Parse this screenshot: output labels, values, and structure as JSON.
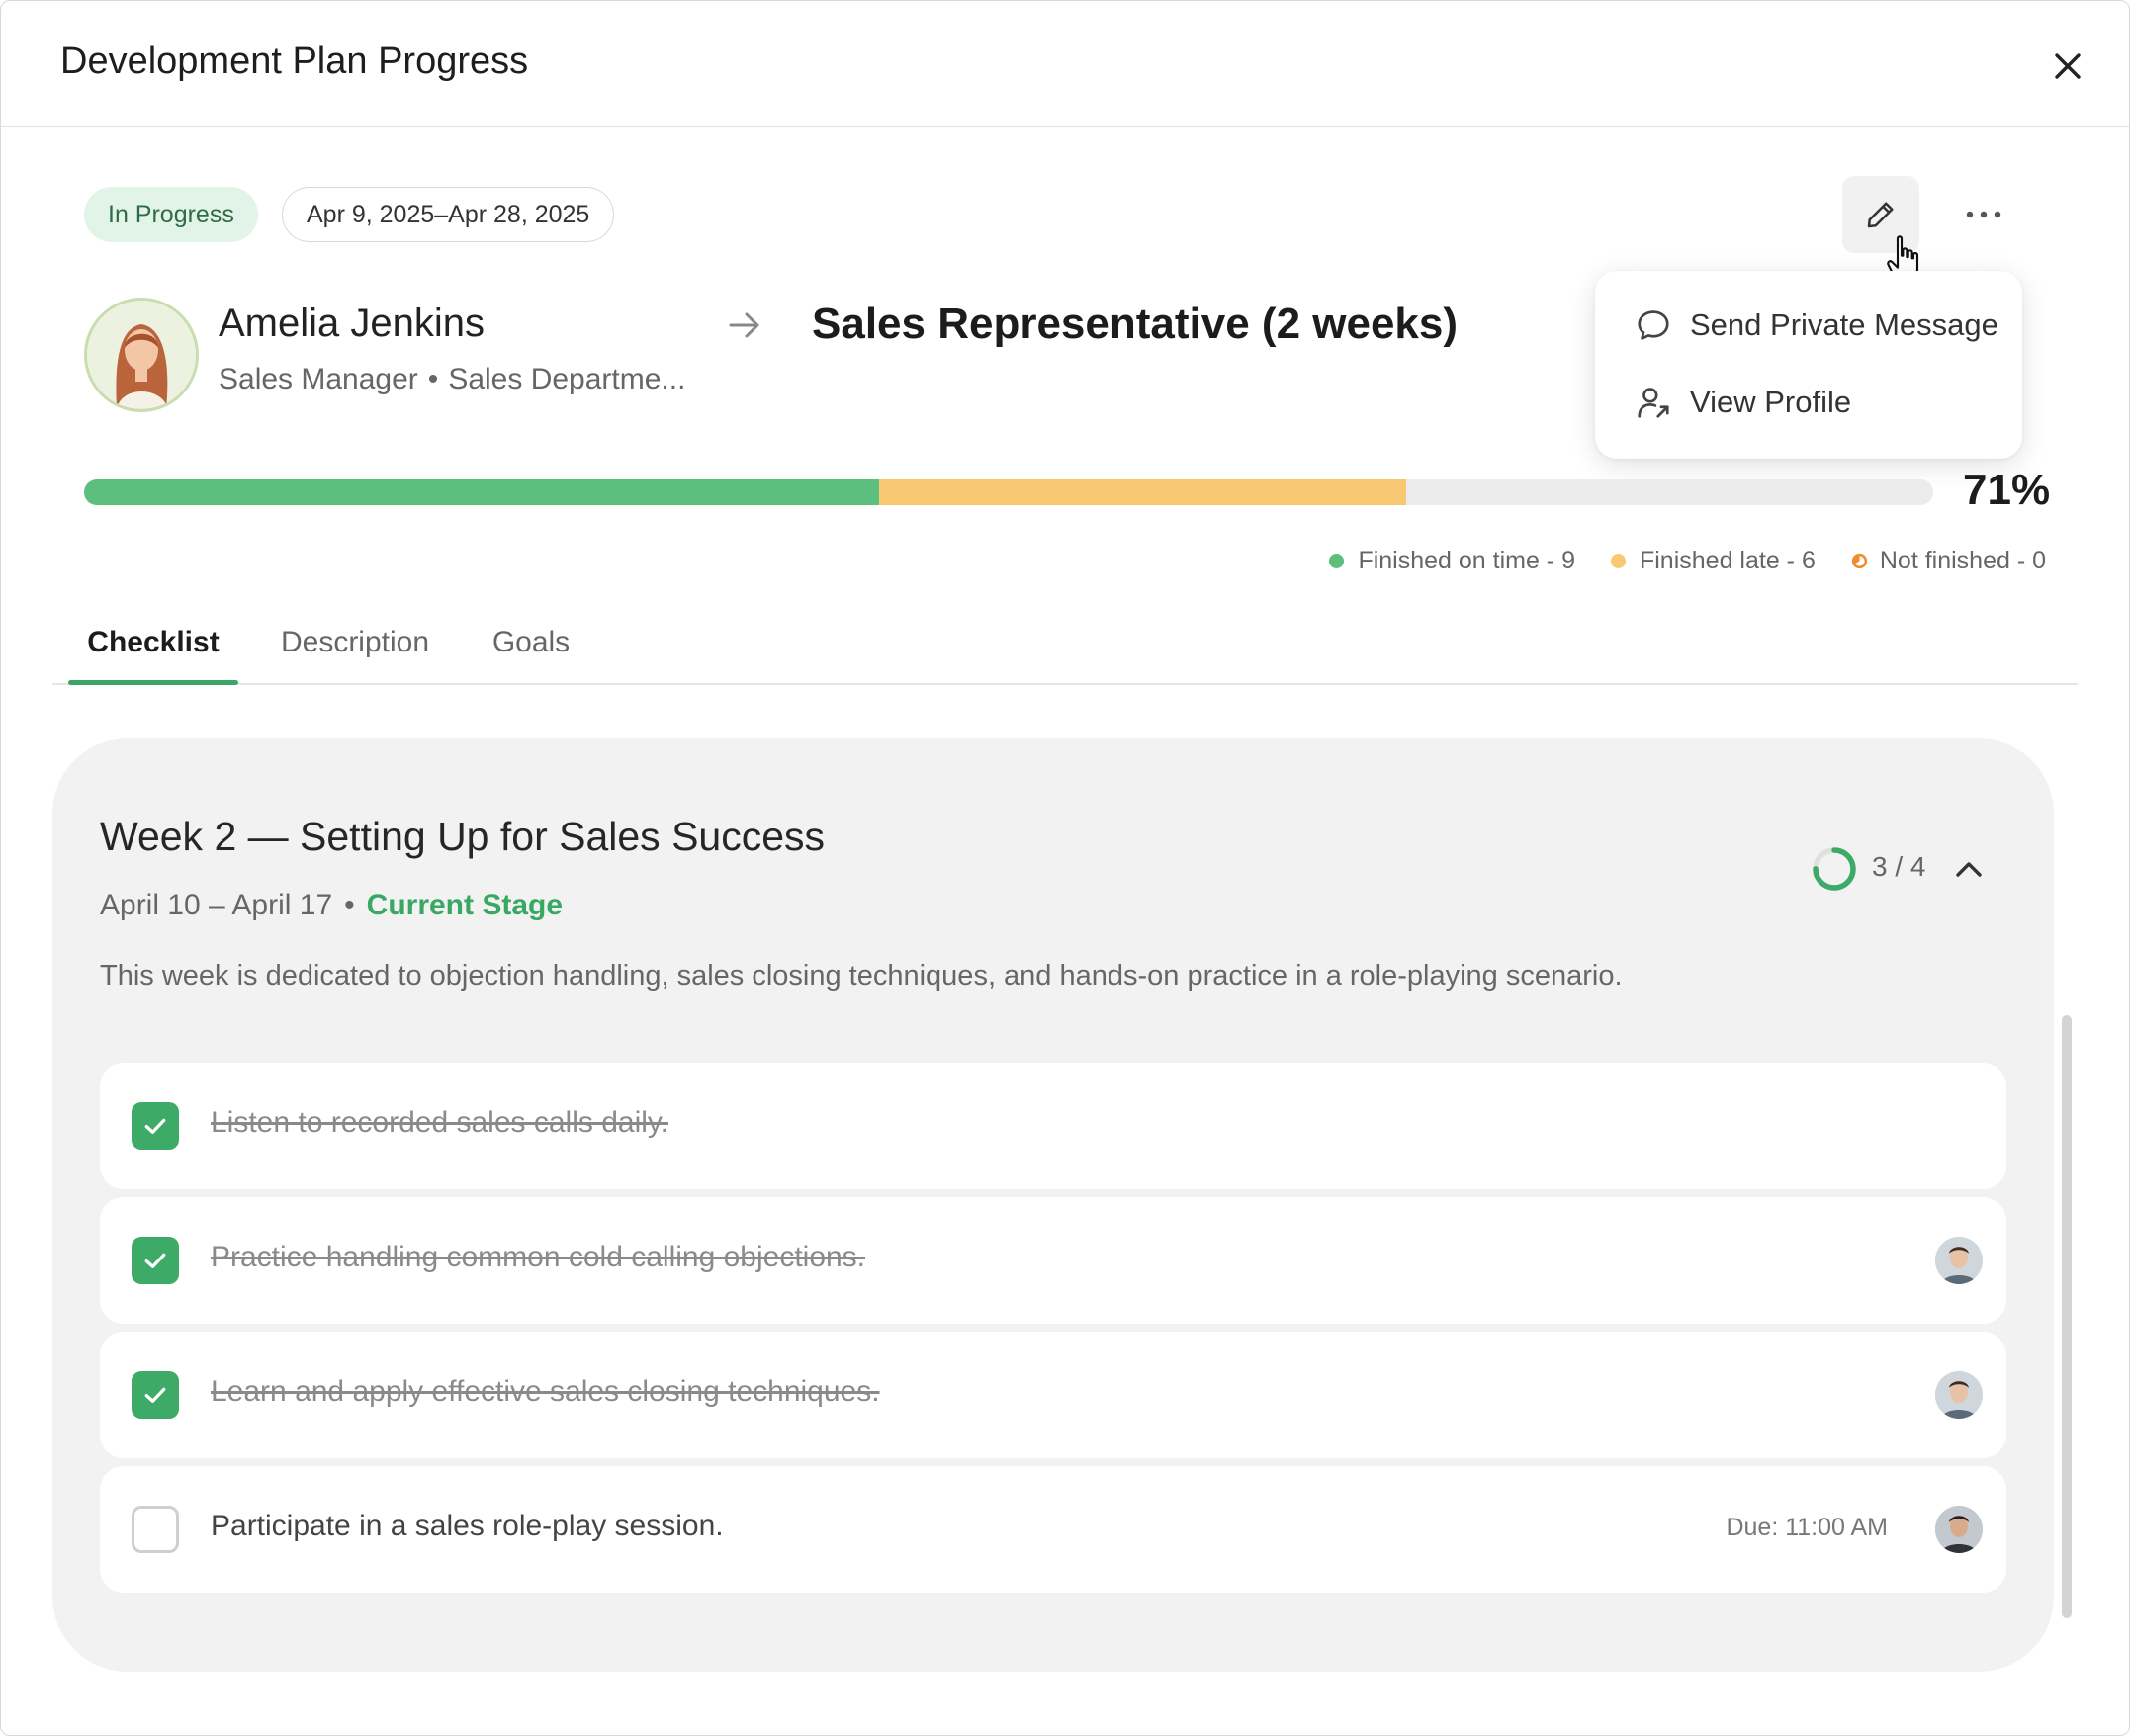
{
  "header": {
    "title": "Development Plan Progress"
  },
  "status_badge": "In Progress",
  "date_range": "Apr 9, 2025–Apr 28, 2025",
  "person": {
    "name": "Amelia Jenkins",
    "role": "Sales Manager",
    "separator": "•",
    "department": "Sales Departme..."
  },
  "plan_title": "Sales Representative (2 weeks)",
  "menu": {
    "items": [
      {
        "label": "Send Private Message",
        "icon": "chat-bubble-icon"
      },
      {
        "label": "View Profile",
        "icon": "user-profile-icon"
      }
    ]
  },
  "progress": {
    "percent_label": "71%",
    "on_time_fraction": 0.43,
    "late_fraction": 0.285
  },
  "legend": [
    {
      "label": "Finished on time - 9",
      "color": "#5cbf7e"
    },
    {
      "label": "Finished late - 6",
      "color": "#f8c873"
    },
    {
      "label": "Not finished - 0",
      "color": "#f08c2e"
    }
  ],
  "tabs": [
    {
      "label": "Checklist",
      "active": true
    },
    {
      "label": "Description",
      "active": false
    },
    {
      "label": "Goals",
      "active": false
    }
  ],
  "week": {
    "title": "Week 2 — Setting Up for Sales Success",
    "dates": "April 10 – April 17",
    "separator": "•",
    "stage": "Current Stage",
    "description": "This week is dedicated to objection handling, sales closing techniques, and hands-on practice in a role-playing scenario.",
    "count": "3 / 4",
    "completion_fraction": 0.75
  },
  "tasks": [
    {
      "text": "Listen to recorded sales calls daily.",
      "done": true
    },
    {
      "text": "Practice handling common cold calling objections.",
      "done": true
    },
    {
      "text": "Learn and apply effective sales closing techniques.",
      "done": true
    },
    {
      "text": "Participate in a sales role-play session.",
      "done": false,
      "due": "Due: 11:00 AM"
    }
  ]
}
